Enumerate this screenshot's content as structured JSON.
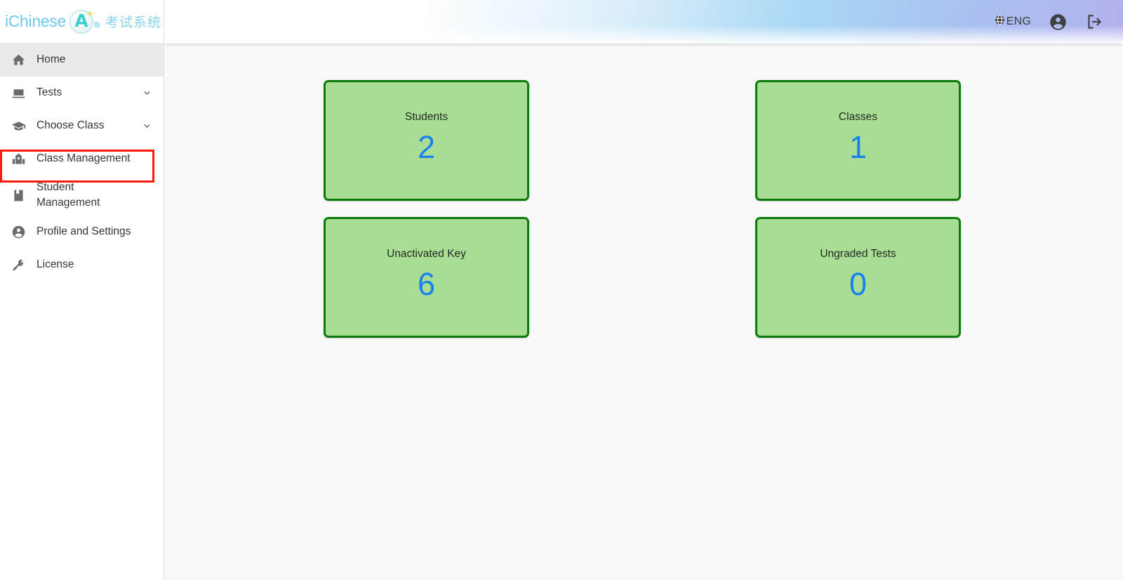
{
  "brand": {
    "word": "iChinese",
    "badge_letter": "A",
    "badge_plus": "+",
    "chinese": "考试系统",
    "logo_icon": "ichinese-a-plus-logo"
  },
  "topbar": {
    "language_label": "ENG",
    "globe_icon": "globe-icon",
    "account_icon": "account-circle-icon",
    "logout_icon": "logout-icon"
  },
  "sidebar": {
    "items": [
      {
        "label": "Home",
        "icon": "home-icon",
        "active": true,
        "caret": false
      },
      {
        "label": "Tests",
        "icon": "laptop-icon",
        "active": false,
        "caret": true
      },
      {
        "label": "Choose Class",
        "icon": "graduation-cap-icon",
        "active": false,
        "caret": true
      },
      {
        "label": "Class Management",
        "icon": "building-icon",
        "active": false,
        "caret": false
      },
      {
        "label": "Student Management",
        "icon": "book-bookmark-icon",
        "active": false,
        "caret": false
      },
      {
        "label": "Profile and Settings",
        "icon": "account-circle-icon",
        "active": false,
        "caret": false
      },
      {
        "label": "License",
        "icon": "key-icon",
        "active": false,
        "caret": false
      }
    ],
    "highlight": {
      "target_label": "Class Management",
      "color": "#fb1b0e"
    }
  },
  "dashboard": {
    "cards": [
      {
        "title": "Students",
        "value": "2"
      },
      {
        "title": "Classes",
        "value": "1"
      },
      {
        "title": "Unactivated Key",
        "value": "6"
      },
      {
        "title": "Ungraded Tests",
        "value": "0"
      }
    ],
    "colors": {
      "card_background": "#a9dd93",
      "card_border": "#0b7c0b",
      "value_text": "#1a82f0",
      "title_text": "#1f2a22",
      "page_background": "#f9f9f9"
    }
  }
}
